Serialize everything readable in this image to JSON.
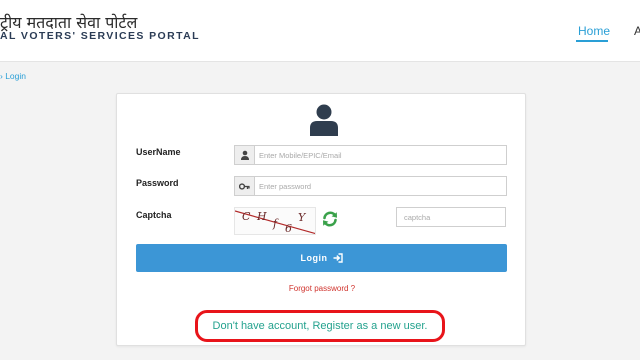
{
  "header": {
    "brand_hindi": "ट्रीय मतदाता सेवा पोर्टल",
    "brand_english": "AL VOTERS' SERVICES PORTAL",
    "nav_home": "Home",
    "nav_more": "A"
  },
  "breadcrumb": {
    "text": "› Login"
  },
  "login_form": {
    "username_label": "UserName",
    "username_placeholder": "Enter Mobile/EPIC/Email",
    "password_label": "Password",
    "password_placeholder": "Enter password",
    "captcha_label": "Captcha",
    "captcha_chars": [
      "C",
      "H",
      "f",
      "6",
      "Y"
    ],
    "captcha_placeholder": "captcha",
    "login_button": "Login",
    "forgot_password": "Forgot password ?",
    "register_link": "Don't have account, Register as a new user."
  },
  "colors": {
    "accent": "#2a9fd6",
    "login_button": "#3c96d6",
    "forgot": "#d0332d",
    "register": "#24a28e",
    "highlight": "#e8141a"
  }
}
